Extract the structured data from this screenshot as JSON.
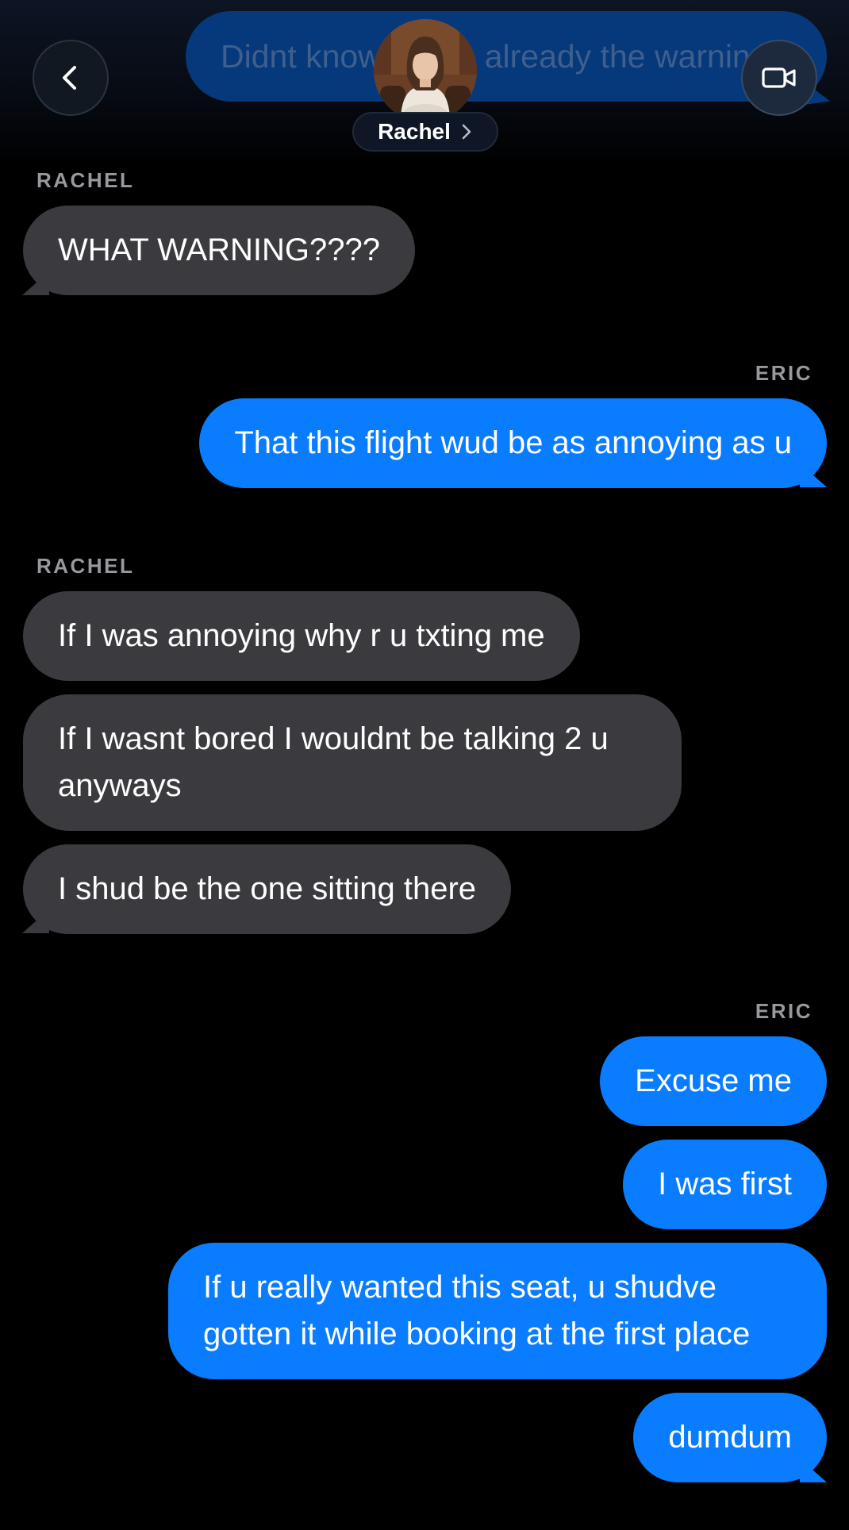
{
  "header": {
    "contact_name": "Rachel",
    "peek_message": "Didnt know u was already the warning"
  },
  "colors": {
    "background": "#000000",
    "incoming_bubble": "#3b3b3f",
    "outgoing_bubble": "#0a7cff",
    "sender_label": "#98989e"
  },
  "icons": {
    "back": "chevron-left-icon",
    "video": "video-camera-icon",
    "name_chevron": "chevron-right-icon"
  },
  "messages": [
    {
      "sender": "RACHEL",
      "direction": "in",
      "texts": [
        "WHAT WARNING????"
      ]
    },
    {
      "sender": "ERIC",
      "direction": "out",
      "texts": [
        "That this flight wud be as annoying as u"
      ]
    },
    {
      "sender": "RACHEL",
      "direction": "in",
      "texts": [
        "If I was annoying why r u txting me",
        "If I wasnt bored I wouldnt be talking 2 u anyways",
        "I shud be the one sitting there"
      ]
    },
    {
      "sender": "ERIC",
      "direction": "out",
      "texts": [
        "Excuse me",
        "I was first",
        "If u really wanted this seat, u shudve gotten it while booking at the first place",
        "dumdum"
      ]
    }
  ]
}
